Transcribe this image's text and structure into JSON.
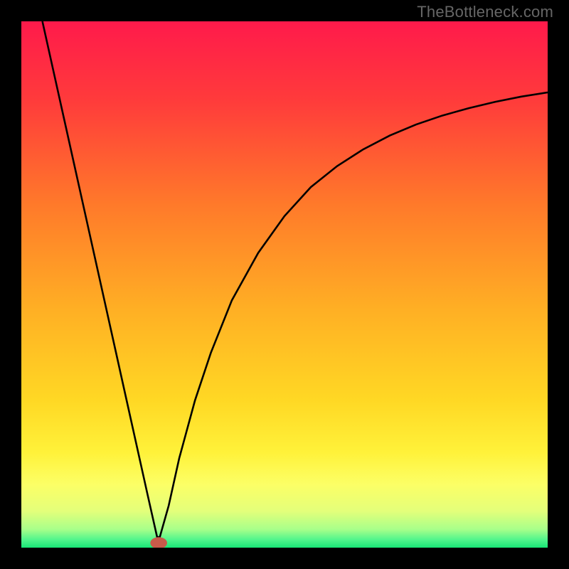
{
  "watermark": "TheBottleneck.com",
  "chart_data": {
    "type": "line",
    "title": "",
    "xlabel": "",
    "ylabel": "",
    "xlim": [
      0,
      100
    ],
    "ylim": [
      0,
      100
    ],
    "background_gradient": {
      "stops": [
        {
          "offset": 0,
          "color": "#ff1a4b"
        },
        {
          "offset": 0.15,
          "color": "#ff3b3b"
        },
        {
          "offset": 0.35,
          "color": "#ff7a2a"
        },
        {
          "offset": 0.55,
          "color": "#ffb024"
        },
        {
          "offset": 0.72,
          "color": "#ffd824"
        },
        {
          "offset": 0.82,
          "color": "#fff23a"
        },
        {
          "offset": 0.88,
          "color": "#fcff66"
        },
        {
          "offset": 0.93,
          "color": "#e4ff7a"
        },
        {
          "offset": 0.965,
          "color": "#a8ff8a"
        },
        {
          "offset": 0.985,
          "color": "#50f58c"
        },
        {
          "offset": 1.0,
          "color": "#18e676"
        }
      ]
    },
    "series": [
      {
        "name": "bottleneck-curve",
        "color": "#000000",
        "x": [
          4,
          6,
          8,
          10,
          12,
          14,
          16,
          18,
          20,
          22,
          24,
          25.8,
          26.3,
          28,
          30,
          33,
          36,
          40,
          45,
          50,
          55,
          60,
          65,
          70,
          75,
          80,
          85,
          90,
          95,
          100
        ],
        "y": [
          100,
          91,
          82,
          73,
          64,
          55,
          46,
          37,
          28,
          19,
          10,
          2,
          2,
          8,
          17,
          28,
          37,
          47,
          56,
          63,
          68.5,
          72.5,
          75.7,
          78.3,
          80.4,
          82.1,
          83.5,
          84.7,
          85.7,
          86.5
        ]
      }
    ],
    "marker": {
      "name": "min-point-marker",
      "x": 26.1,
      "y": 0.9,
      "rx": 1.6,
      "ry": 1.1,
      "color": "#c85a4a"
    }
  }
}
